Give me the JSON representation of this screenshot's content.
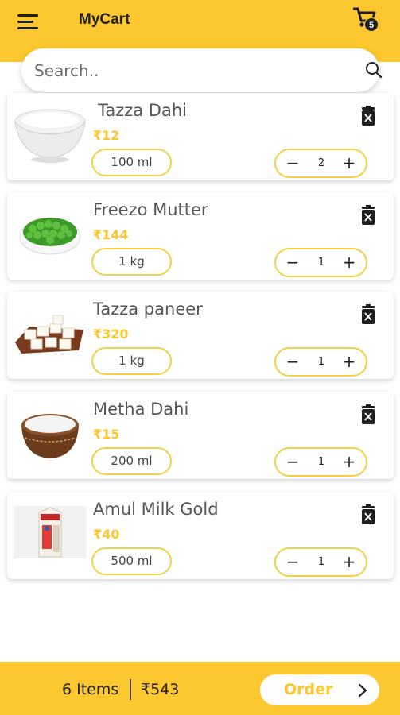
{
  "header": {
    "title": "MyCart",
    "cart_count": "5"
  },
  "search": {
    "placeholder": "Search.."
  },
  "items": [
    {
      "name": "Tazza Dahi",
      "price": "₹12",
      "unit": "100 ml",
      "quantity": "2",
      "image": "curd-bowl"
    },
    {
      "name": "Freezo Mutter",
      "price": "₹144",
      "unit": "1 kg",
      "quantity": "1",
      "image": "green-peas"
    },
    {
      "name": "Tazza paneer",
      "price": "₹320",
      "unit": "1 kg",
      "quantity": "1",
      "image": "paneer-cubes"
    },
    {
      "name": "Metha Dahi",
      "price": "₹15",
      "unit": "200 ml",
      "quantity": "1",
      "image": "clay-pot-curd"
    },
    {
      "name": "Amul Milk Gold",
      "price": "₹40",
      "unit": "500 ml",
      "quantity": "1",
      "image": "milk-carton"
    }
  ],
  "stepper": {
    "minus": "−",
    "plus": "+"
  },
  "summary": {
    "items_label": "6 Items",
    "total": "₹543",
    "order_label": "Order"
  },
  "colors": {
    "accent": "#fcc72f",
    "text": "#555555"
  }
}
